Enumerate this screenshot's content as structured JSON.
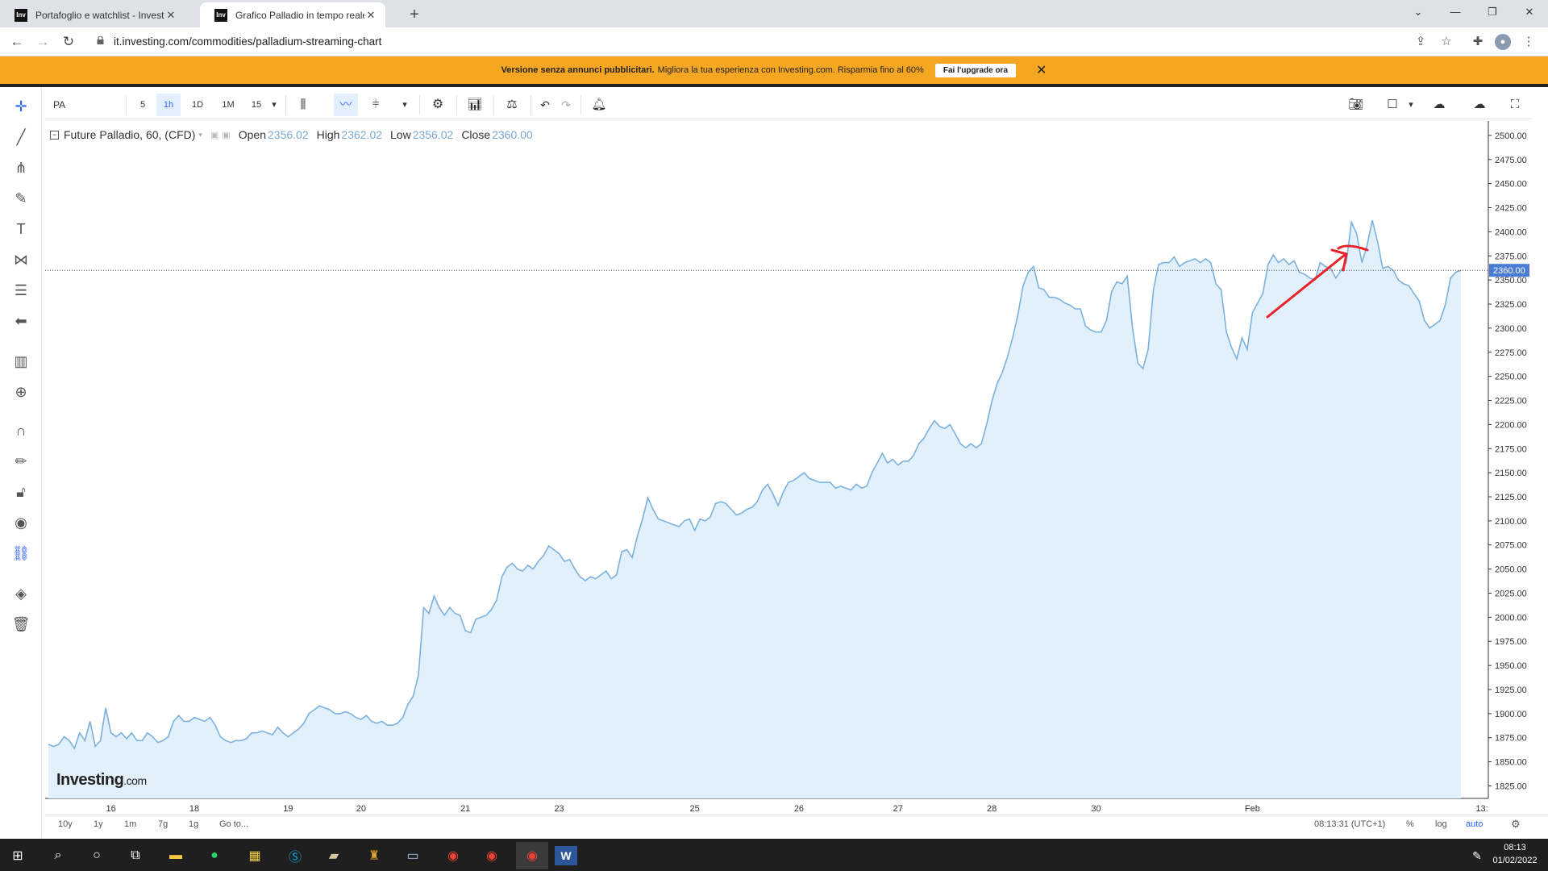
{
  "browser": {
    "tabs": [
      {
        "title": "Portafoglio e watchlist - Investing",
        "active": false
      },
      {
        "title": "Grafico Palladio in tempo reale -",
        "active": true
      }
    ],
    "url": "it.investing.com/commodities/palladium-streaming-chart"
  },
  "banner": {
    "strong_text": "Versione senza annunci pubblicitari.",
    "text": "Migliora la tua esperienza con Investing.com. Risparmia fino al 60%",
    "button_label": "Fai l'upgrade ora",
    "close_label": "✕"
  },
  "toolbar": {
    "symbol": "PA",
    "intervals": [
      "5",
      "1h",
      "1D",
      "1M",
      "15"
    ],
    "selected_interval": "1h"
  },
  "legend": {
    "title": "Future Palladio, 60, (CFD)",
    "open_label": "Open",
    "open": "2356.02",
    "high_label": "High",
    "high": "2362.02",
    "low_label": "Low",
    "low": "2356.02",
    "close_label": "Close",
    "close": "2360.00"
  },
  "watermark": {
    "brand": "Investing",
    "suffix": ".com"
  },
  "bottom_bar": {
    "ranges": [
      "10y",
      "1y",
      "1m",
      "7g",
      "1g"
    ],
    "goto_label": "Go to...",
    "time": "08:13:31 (UTC+1)",
    "percent_label": "%",
    "log_label": "log",
    "auto_label": "auto"
  },
  "taskbar": {
    "time": "08:13",
    "date": "01/02/2022"
  },
  "chart_data": {
    "type": "area",
    "title": "Future Palladio, 60, (CFD)",
    "xlabel": "",
    "ylabel": "",
    "x_ticks": [
      "16",
      "18",
      "19",
      "20",
      "21",
      "23",
      "25",
      "26",
      "27",
      "28",
      "30",
      "Feb",
      "13:"
    ],
    "y_ticks": [
      "2500.00",
      "2475.00",
      "2450.00",
      "2425.00",
      "2400.00",
      "2375.00",
      "2350.00",
      "2325.00",
      "2300.00",
      "2275.00",
      "2250.00",
      "2225.00",
      "2200.00",
      "2175.00",
      "2150.00",
      "2125.00",
      "2100.00",
      "2075.00",
      "2050.00",
      "2025.00",
      "2000.00",
      "1975.00",
      "1950.00",
      "1925.00",
      "1900.00",
      "1875.00",
      "1850.00",
      "1825.00"
    ],
    "ylim": [
      1812,
      2515
    ],
    "last_price": 2360.0,
    "last_price_label": "2360.00",
    "colors": {
      "line": "#7cb1de",
      "fill": "#e1f0fa",
      "last_price_bg": "#4a7cd6",
      "annotation": "#e8232a"
    },
    "series": [
      {
        "values": [
          1868,
          1866,
          1868,
          1876,
          1872,
          1864,
          1880,
          1872,
          1892,
          1866,
          1872,
          1906,
          1880,
          1876,
          1880,
          1874,
          1880,
          1872,
          1872,
          1880,
          1876,
          1870,
          1872,
          1876,
          1892,
          1898,
          1892,
          1892,
          1896,
          1894,
          1892,
          1896,
          1888,
          1876,
          1872,
          1870,
          1872,
          1872,
          1874,
          1880,
          1880,
          1882,
          1880,
          1878,
          1886,
          1880,
          1876,
          1880,
          1884,
          1890,
          1900,
          1904,
          1908,
          1906,
          1904,
          1900,
          1900,
          1902,
          1900,
          1896,
          1894,
          1898,
          1892,
          1890,
          1892,
          1888,
          1888,
          1890,
          1896,
          1910,
          1918,
          1940,
          2010,
          2004,
          2022,
          2010,
          2002,
          2010,
          2004,
          2002,
          1986,
          1984,
          1998,
          2000,
          2002,
          2008,
          2018,
          2042,
          2052,
          2056,
          2050,
          2048,
          2054,
          2050,
          2058,
          2064,
          2074,
          2070,
          2066,
          2058,
          2060,
          2050,
          2042,
          2038,
          2042,
          2040,
          2044,
          2048,
          2040,
          2044,
          2068,
          2070,
          2062,
          2084,
          2102,
          2124,
          2112,
          2102,
          2100,
          2098,
          2096,
          2094,
          2100,
          2102,
          2090,
          2102,
          2100,
          2104,
          2118,
          2120,
          2118,
          2112,
          2106,
          2108,
          2112,
          2114,
          2120,
          2132,
          2138,
          2128,
          2116,
          2130,
          2140,
          2142,
          2146,
          2150,
          2144,
          2142,
          2140,
          2140,
          2140,
          2134,
          2136,
          2134,
          2132,
          2138,
          2134,
          2136,
          2150,
          2160,
          2170,
          2160,
          2164,
          2158,
          2162,
          2162,
          2168,
          2180,
          2186,
          2196,
          2204,
          2198,
          2196,
          2200,
          2190,
          2180,
          2176,
          2180,
          2176,
          2180,
          2200,
          2224,
          2242,
          2254,
          2270,
          2290,
          2314,
          2344,
          2358,
          2364,
          2342,
          2340,
          2332,
          2332,
          2330,
          2326,
          2324,
          2320,
          2320,
          2302,
          2298,
          2296,
          2296,
          2308,
          2338,
          2348,
          2346,
          2354,
          2300,
          2264,
          2258,
          2278,
          2340,
          2366,
          2368,
          2368,
          2374,
          2364,
          2368,
          2370,
          2372,
          2368,
          2372,
          2368,
          2346,
          2340,
          2296,
          2280,
          2268,
          2290,
          2278,
          2316,
          2326,
          2336,
          2366,
          2376,
          2368,
          2372,
          2366,
          2370,
          2358,
          2356,
          2352,
          2350,
          2368,
          2364,
          2362,
          2352,
          2360,
          2368,
          2410,
          2398,
          2368,
          2386,
          2412,
          2390,
          2362,
          2364,
          2360,
          2350,
          2346,
          2344,
          2336,
          2328,
          2308,
          2300,
          2304,
          2308,
          2324,
          2352,
          2358,
          2360
        ]
      }
    ],
    "x_tick_index": {
      "16": 12,
      "18": 28,
      "19": 46,
      "20": 60,
      "21": 80,
      "23": 98,
      "25": 124,
      "26": 144,
      "27": 163,
      "28": 181,
      "30": 201,
      "Feb": 231
    }
  }
}
